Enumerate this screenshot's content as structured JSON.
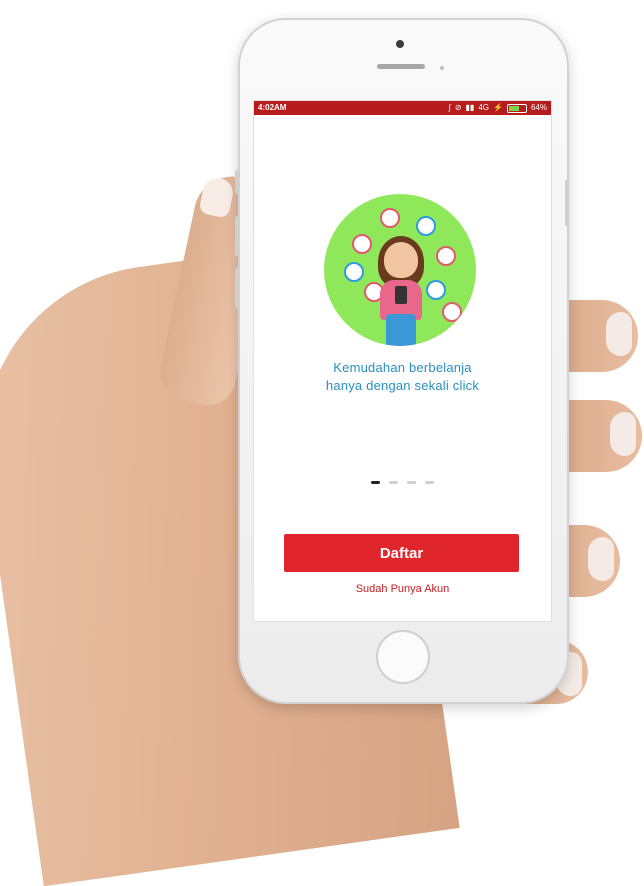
{
  "status_bar": {
    "time": "4:02AM",
    "network": "4G",
    "battery": "64%",
    "battery_level": 0.64
  },
  "onboarding": {
    "tagline_line1": "Kemudahan berbelanja",
    "tagline_line2": "hanya dengan sekali click",
    "page_count": 4,
    "active_page": 1
  },
  "actions": {
    "register_label": "Daftar",
    "login_link": "Sudah Punya Akun"
  },
  "colors": {
    "status_bar": "#b71c1c",
    "primary": "#e0262c",
    "tagline": "#2a8fc4",
    "illustration_bg": "#8fe85a"
  }
}
